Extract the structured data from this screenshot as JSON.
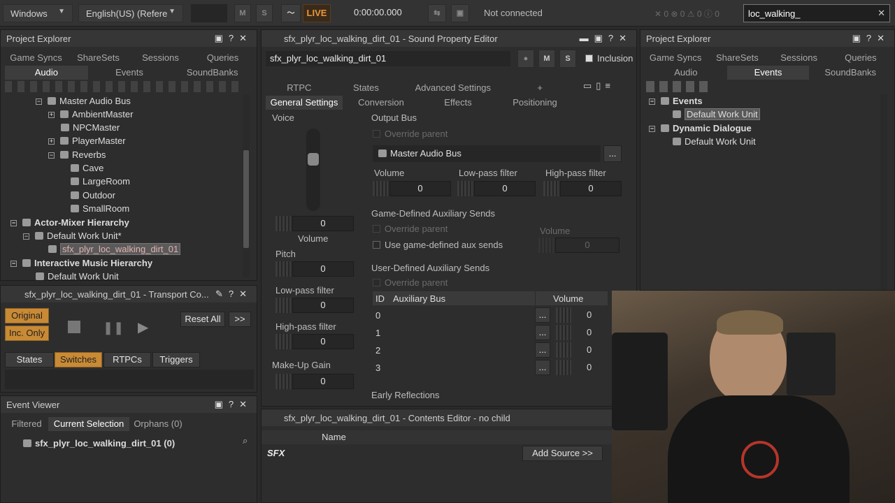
{
  "toolbar": {
    "layout": "Windows",
    "language": "English(US) (Refere",
    "m": "M",
    "s": "S",
    "live": "LIVE",
    "time": "0:00:00.000",
    "connection": "Not connected",
    "counts": "0  0  0  0",
    "search_value": "loc_walking_"
  },
  "left_explorer": {
    "title": "Project Explorer",
    "tabs_row1": [
      "Game Syncs",
      "ShareSets",
      "Sessions",
      "Queries"
    ],
    "tabs_row2": [
      "Audio",
      "Events",
      "SoundBanks"
    ],
    "tree": [
      "Master Audio Bus",
      "AmbientMaster",
      "NPCMaster",
      "PlayerMaster",
      "Reverbs",
      "Cave",
      "LargeRoom",
      "Outdoor",
      "SmallRoom",
      "Actor-Mixer Hierarchy",
      "Default Work Unit*",
      "sfx_plyr_loc_walking_dirt_01",
      "Interactive Music Hierarchy",
      "Default Work Unit"
    ]
  },
  "transport": {
    "title": "sfx_plyr_loc_walking_dirt_01 - Transport Co...",
    "original": "Original",
    "inc_only": "Inc. Only",
    "reset_all": "Reset All",
    "more": ">>",
    "tabs": [
      "States",
      "Switches",
      "RTPCs",
      "Triggers"
    ]
  },
  "event_viewer": {
    "title": "Event Viewer",
    "tabs": [
      "Filtered",
      "Current Selection",
      "Orphans (0)"
    ],
    "item": "sfx_plyr_loc_walking_dirt_01 (0)"
  },
  "editor": {
    "title": "sfx_plyr_loc_walking_dirt_01 - Sound Property Editor",
    "name": "sfx_plyr_loc_walking_dirt_01",
    "m": "M",
    "s": "S",
    "inclusion": "Inclusion",
    "tabs_row1": [
      "RTPC",
      "States",
      "Advanced Settings",
      "+"
    ],
    "tabs_row2": [
      "General Settings",
      "Conversion",
      "Effects",
      "Positioning"
    ],
    "voice": "Voice",
    "volume_label": "Volume",
    "volume_value": "0",
    "pitch": "Pitch",
    "pitch_value": "0",
    "lpf": "Low-pass filter",
    "lpf_value": "0",
    "hpf": "High-pass filter",
    "hpf_value": "0",
    "makeup": "Make-Up Gain",
    "makeup_value": "0",
    "output_bus": "Output Bus",
    "override_parent": "Override parent",
    "master_bus": "Master Audio Bus",
    "dots": "...",
    "ob_volume": "Volume",
    "ob_lpf": "Low-pass filter",
    "ob_hpf": "High-pass filter",
    "ob_volume_v": "0",
    "ob_lpf_v": "0",
    "ob_hpf_v": "0",
    "game_sends": "Game-Defined Auxiliary Sends",
    "use_game_aux": "Use game-defined aux sends",
    "gs_volume": "Volume",
    "gs_volume_v": "0",
    "user_sends": "User-Defined Auxiliary Sends",
    "col_id": "ID",
    "col_bus": "Auxiliary Bus",
    "col_volume": "Volume",
    "send_rows": [
      {
        "id": "0",
        "v": "0"
      },
      {
        "id": "1",
        "v": "0"
      },
      {
        "id": "2",
        "v": "0"
      },
      {
        "id": "3",
        "v": "0"
      }
    ],
    "early_reflections": "Early Reflections"
  },
  "contents": {
    "title": "sfx_plyr_loc_walking_dirt_01 - Contents Editor - no child",
    "col_name": "Name",
    "sfx": "SFX",
    "add_source": "Add Source >>"
  },
  "right_explorer": {
    "title": "Project Explorer",
    "tabs_row1": [
      "Game Syncs",
      "ShareSets",
      "Sessions",
      "Queries"
    ],
    "tabs_row2": [
      "Audio",
      "Events",
      "SoundBanks"
    ],
    "tree": [
      "Events",
      "Default Work Unit",
      "Dynamic Dialogue",
      "Default Work Unit"
    ]
  },
  "colors": {
    "accent": "#c98a35",
    "live": "#e8973a"
  }
}
